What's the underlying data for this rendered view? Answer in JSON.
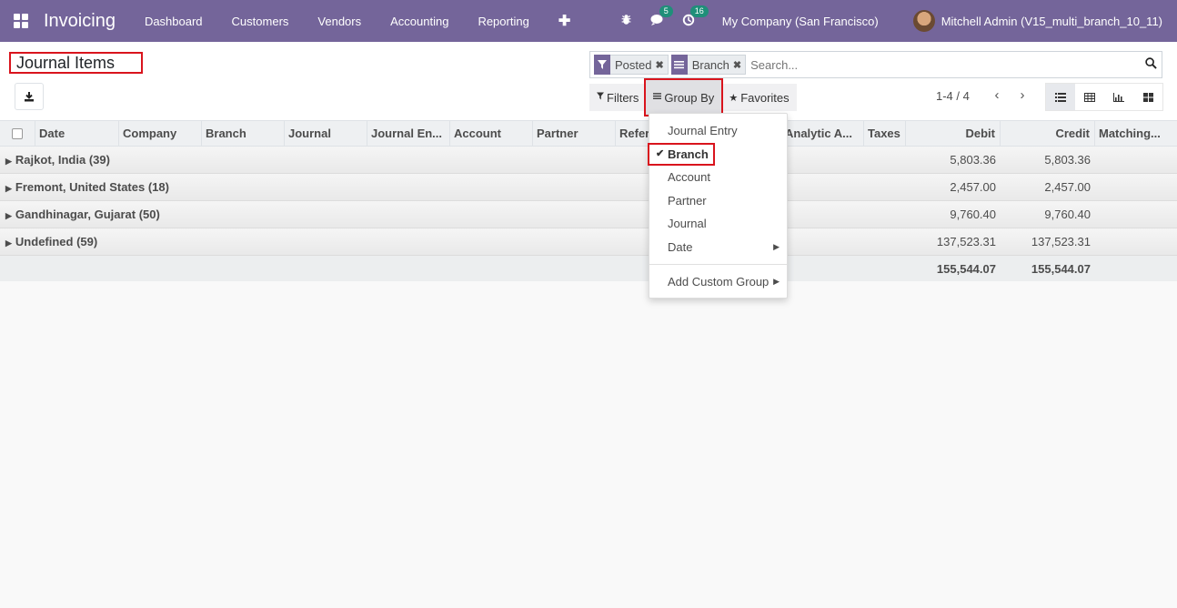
{
  "navbar": {
    "app_name": "Invoicing",
    "menu": [
      "Dashboard",
      "Customers",
      "Vendors",
      "Accounting",
      "Reporting"
    ],
    "messages_count": "5",
    "activities_count": "16",
    "company": "My Company (San Francisco)",
    "user": "Mitchell Admin (V15_multi_branch_10_11)"
  },
  "control": {
    "title": "Journal Items",
    "facets": [
      {
        "icon": "filter-icon",
        "label": "Posted"
      },
      {
        "icon": "group-icon",
        "label": "Branch"
      }
    ],
    "search_placeholder": "Search...",
    "filters_label": "Filters",
    "groupby_label": "Group By",
    "favorites_label": "Favorites",
    "pager": "1-4 / 4"
  },
  "table": {
    "columns": [
      "Date",
      "Company",
      "Branch",
      "Journal",
      "Journal En...",
      "Account",
      "Partner",
      "Refer",
      "Analytic A...",
      "Taxes",
      "Debit",
      "Credit",
      "Matching..."
    ],
    "groups": [
      {
        "name": "Rajkot, India (39)",
        "debit": "5,803.36",
        "credit": "5,803.36"
      },
      {
        "name": "Fremont, United States (18)",
        "debit": "2,457.00",
        "credit": "2,457.00"
      },
      {
        "name": "Gandhinagar, Gujarat (50)",
        "debit": "9,760.40",
        "credit": "9,760.40"
      },
      {
        "name": "Undefined (59)",
        "debit": "137,523.31",
        "credit": "137,523.31"
      }
    ],
    "total_debit": "155,544.07",
    "total_credit": "155,544.07"
  },
  "groupby_menu": {
    "items": [
      "Journal Entry",
      "Branch",
      "Account",
      "Partner",
      "Journal",
      "Date"
    ],
    "selected": "Branch",
    "custom": "Add Custom Group"
  },
  "colors": {
    "navbar": "#74659a",
    "highlight": "#d9141d",
    "badge": "#1f8f79"
  }
}
